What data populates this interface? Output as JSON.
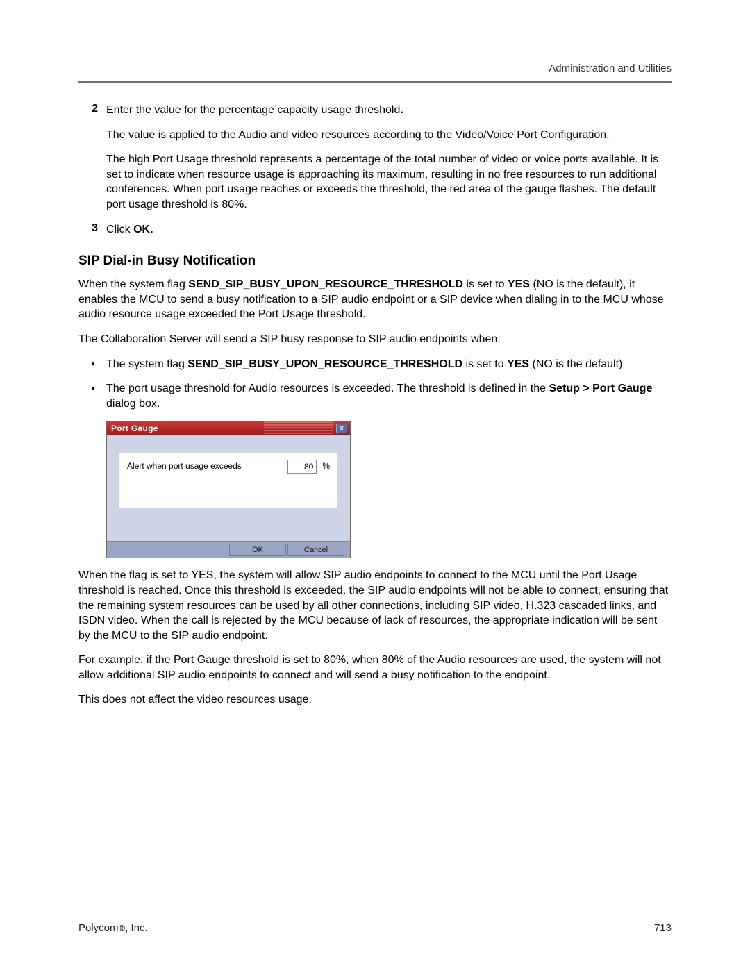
{
  "header": {
    "section_label": "Administration and Utilities"
  },
  "steps": {
    "s2": {
      "num": "2",
      "p1_a": "Enter the value for the percentage capacity usage threshold",
      "p1_b": ".",
      "p2": "The value is applied to the Audio and video resources according to the Video/Voice Port Configuration.",
      "p3": "The high Port Usage threshold represents a percentage of the total number of video or voice ports available. It is set to indicate when resource usage is approaching its maximum, resulting in no free resources to run additional conferences. When port usage reaches or exceeds the threshold, the red area of the gauge flashes. The default port usage threshold is 80%."
    },
    "s3": {
      "num": "3",
      "p1_a": "Click ",
      "p1_b": "OK.",
      "p1_c": ""
    }
  },
  "section_title": "SIP Dial-in Busy Notification",
  "p_intro_a": "When the system flag ",
  "p_intro_b": "SEND_SIP_BUSY_UPON_RESOURCE_THRESHOLD",
  "p_intro_c": " is set to ",
  "p_intro_d": "YES",
  "p_intro_e": " (NO is the default), it enables the MCU to send a busy notification to a SIP audio endpoint or a SIP device when dialing in to the MCU whose audio resource usage exceeded the Port Usage threshold.",
  "p_when": "The Collaboration Server will send a SIP busy response to SIP audio endpoints when:",
  "bullets": {
    "b1_a": "The system flag ",
    "b1_b": "SEND_SIP_BUSY_UPON_RESOURCE_THRESHOLD",
    "b1_c": " is set to ",
    "b1_d": "YES",
    "b1_e": " (NO is the default)",
    "b2_a": "The port usage threshold for Audio resources is exceeded. The threshold is defined in the ",
    "b2_b": "Setup > Port Gauge",
    "b2_c": " dialog box."
  },
  "dialog": {
    "title": "Port Gauge",
    "close": "x",
    "label": "Alert when port usage exceeds",
    "value": "80",
    "percent": "%",
    "ok": "OK",
    "cancel": "Cancel"
  },
  "p_after1": "When the flag is set to YES, the system will allow SIP audio endpoints to connect to the MCU until the Port Usage threshold is reached. Once this threshold is exceeded, the SIP audio endpoints will not be able to connect, ensuring that the remaining system resources can be used by all other connections, including SIP video, H.323 cascaded links, and ISDN video. When the call is rejected by the MCU because of lack of resources, the appropriate indication will be sent by the MCU to the SIP audio endpoint.",
  "p_after2": "For example, if the Port Gauge threshold is set to 80%, when 80% of the Audio resources are used, the system will not allow additional SIP audio endpoints to connect and will send a busy notification to the endpoint.",
  "p_after3": "This does not affect the video resources usage.",
  "footer": {
    "company_a": "Polycom",
    "company_b": "®",
    "company_c": ", Inc.",
    "page": "713"
  }
}
